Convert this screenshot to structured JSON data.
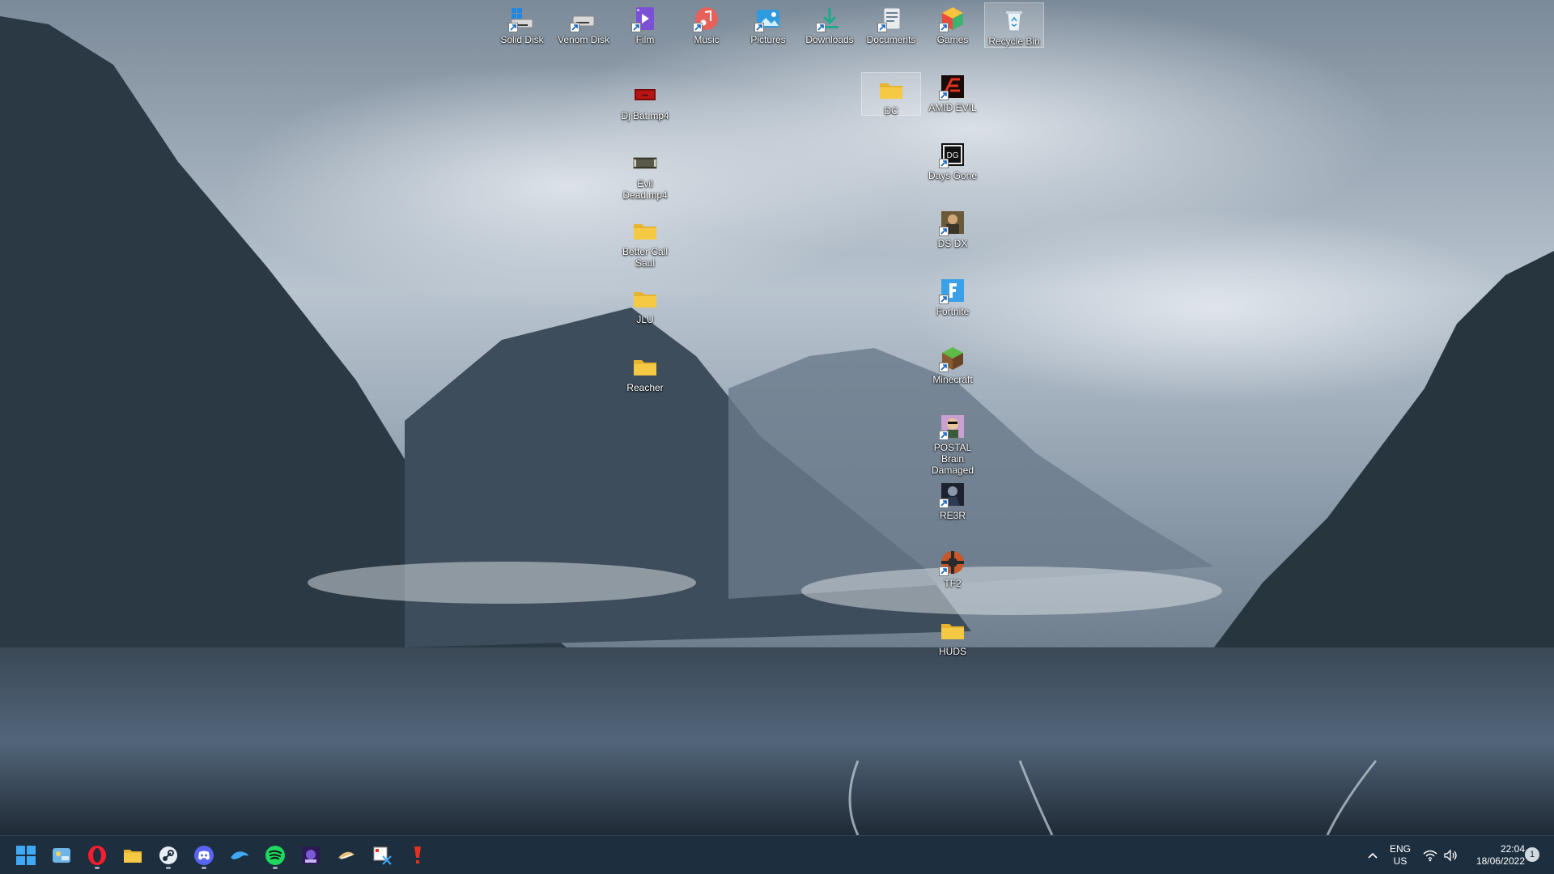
{
  "desktop": {
    "top_row": [
      {
        "label": "Solid Disk",
        "icon": "drive-icon"
      },
      {
        "label": "Venom Disk",
        "icon": "drive-icon"
      },
      {
        "label": "Film",
        "icon": "video-folder-icon"
      },
      {
        "label": "Music",
        "icon": "music-folder-icon"
      },
      {
        "label": "Pictures",
        "icon": "pictures-folder-icon"
      },
      {
        "label": "Downloads",
        "icon": "downloads-folder-icon"
      },
      {
        "label": "Documents",
        "icon": "documents-folder-icon"
      },
      {
        "label": "Games",
        "icon": "games-icon"
      },
      {
        "label": "Recycle Bin",
        "icon": "recycle-bin-icon"
      }
    ],
    "col_left": [
      {
        "label": "Dj Bat.mp4",
        "icon": "video-file-icon"
      },
      {
        "label": "Evil Dead.mp4",
        "icon": "video-file-icon"
      },
      {
        "label": "Better Call Saul",
        "icon": "folder-icon"
      },
      {
        "label": "JLU",
        "icon": "folder-icon"
      },
      {
        "label": "Reacher",
        "icon": "folder-icon"
      }
    ],
    "dc_folder": {
      "label": "DC",
      "icon": "folder-icon"
    },
    "col_right": [
      {
        "label": "AMID EVIL",
        "icon": "amid-evil-icon"
      },
      {
        "label": "Days Gone",
        "icon": "days-gone-icon"
      },
      {
        "label": "DS DX",
        "icon": "ds-dx-icon"
      },
      {
        "label": "Fortnite",
        "icon": "fortnite-icon"
      },
      {
        "label": "Minecraft",
        "icon": "minecraft-icon"
      },
      {
        "label": "POSTAL Brain Damaged",
        "icon": "postal-icon"
      },
      {
        "label": "RE3R",
        "icon": "re3r-icon"
      },
      {
        "label": "TF2",
        "icon": "tf2-icon"
      },
      {
        "label": "HUDS",
        "icon": "folder-icon"
      }
    ]
  },
  "taskbar": {
    "apps": [
      "start-icon",
      "widgets-icon",
      "opera-icon",
      "file-explorer-icon",
      "steam-icon",
      "discord-icon",
      "dolphin-icon",
      "spotify-icon",
      "game-launcher-icon",
      "cloud-app-icon",
      "snipping-tool-icon",
      "red-app-icon"
    ],
    "language": "ENG",
    "region": "US",
    "time": "22:04",
    "date": "18/06/2022",
    "notification_count": "1"
  },
  "colors": {
    "taskbar_bg": "#1d2e3f",
    "folder_yellow": "#f6c945",
    "spotify_green": "#1ed760",
    "discord_blurple": "#5865f2"
  }
}
